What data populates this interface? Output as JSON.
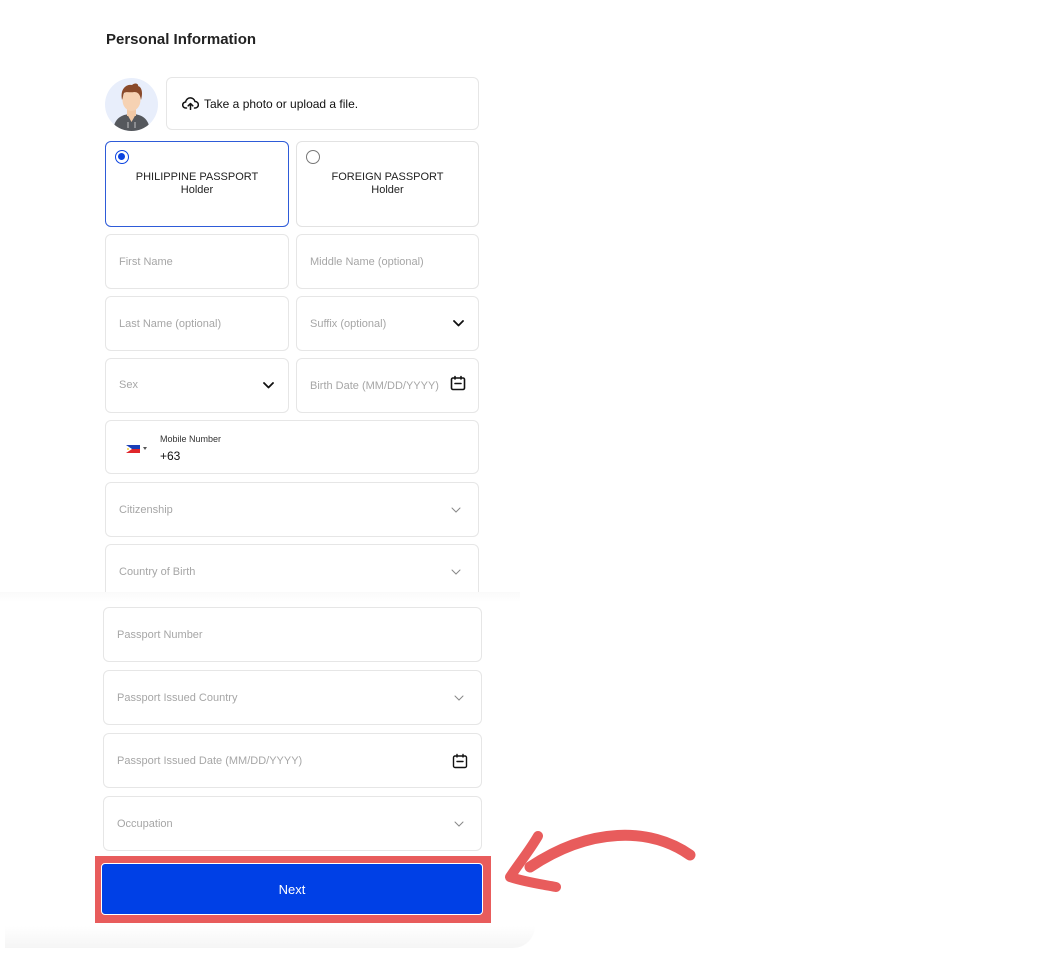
{
  "page": {
    "title": "Personal Information"
  },
  "photo": {
    "upload_label": "Take a photo or upload a file.",
    "upload_icon": "cloud-upload-icon",
    "avatar_icon": "avatar-placeholder-icon"
  },
  "passport_type": {
    "options": [
      {
        "line1": "PHILIPPINE PASSPORT",
        "line2": "Holder",
        "selected": true
      },
      {
        "line1": "FOREIGN PASSPORT",
        "line2": "Holder",
        "selected": false
      }
    ]
  },
  "fields": {
    "first_name": {
      "placeholder": "First Name"
    },
    "middle_name": {
      "placeholder": "Middle Name (optional)"
    },
    "last_name": {
      "placeholder": "Last Name (optional)"
    },
    "suffix": {
      "placeholder": "Suffix (optional)",
      "icon": "chevron-down-icon"
    },
    "sex": {
      "placeholder": "Sex",
      "icon": "chevron-down-icon"
    },
    "birth_date": {
      "placeholder": "Birth Date (MM/DD/YYYY)",
      "icon": "calendar-icon"
    },
    "mobile": {
      "label": "Mobile Number",
      "value": "+63",
      "country_flag": "philippines-flag-icon"
    },
    "citizenship": {
      "placeholder": "Citizenship",
      "icon": "chevron-down-icon"
    },
    "country_of_birth": {
      "placeholder": "Country of Birth",
      "icon": "chevron-down-icon"
    },
    "passport_number": {
      "placeholder": "Passport Number"
    },
    "passport_issued_country": {
      "placeholder": "Passport Issued Country",
      "icon": "chevron-down-icon"
    },
    "passport_issued_date": {
      "placeholder": "Passport Issued Date (MM/DD/YYYY)",
      "icon": "calendar-icon"
    },
    "occupation": {
      "placeholder": "Occupation",
      "icon": "chevron-down-icon"
    }
  },
  "actions": {
    "next_label": "Next"
  },
  "colors": {
    "primary": "#0040e6",
    "annotation": "#e85c5c",
    "selected_border": "#2e5bd8"
  }
}
